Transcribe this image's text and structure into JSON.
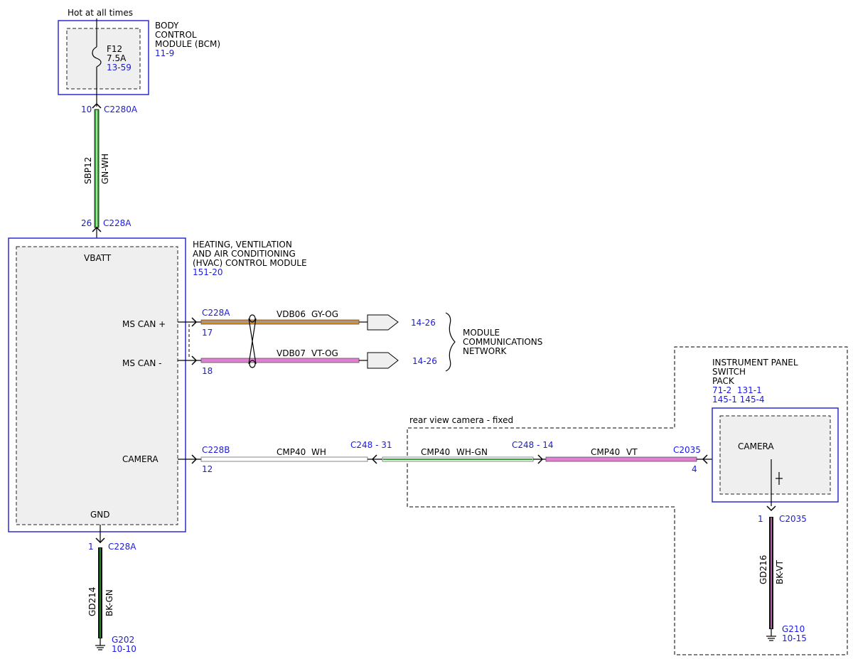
{
  "colors": {
    "module_border": "#2b2bd6",
    "module_fill": "#efefef",
    "reference_text": "#1a1ae0",
    "wire_green": "#2fa82f",
    "wire_white": "#ffffff",
    "wire_black": "#111111",
    "wire_gray": "#9a9a9a",
    "wire_orange": "#e08a1e",
    "wire_violet": "#e27fd2"
  },
  "bcm": {
    "power_label": "Hot at all times",
    "title_lines": [
      "BODY",
      "CONTROL",
      "MODULE (BCM)"
    ],
    "page_ref": "11-9",
    "fuse": {
      "name": "F12",
      "rating": "7.5A",
      "page_ref": "13-59"
    },
    "connector": {
      "pin": "10",
      "name": "C2280A"
    }
  },
  "feed_wire": {
    "circuit": "SBP12",
    "color_code": "GN-WH"
  },
  "hvac": {
    "title_lines": [
      "HEATING, VENTILATION",
      "AND AIR CONDITIONING",
      "(HVAC) CONTROL MODULE"
    ],
    "page_ref": "151-20",
    "feed_connector": {
      "pin": "26",
      "name": "C228A"
    },
    "pins": {
      "vbatt": "VBATT",
      "ms_can_plus": "MS CAN +",
      "ms_can_minus": "MS CAN -",
      "camera": "CAMERA",
      "gnd": "GND"
    },
    "ground_connector": {
      "pin": "1",
      "name": "C228A"
    }
  },
  "can_bus": {
    "connector": "C228A",
    "plus": {
      "pin": "17",
      "circuit": "VDB06",
      "color_code": "GY-OG",
      "page_ref": "14-26"
    },
    "minus": {
      "pin": "18",
      "circuit": "VDB07",
      "color_code": "VT-OG",
      "page_ref": "14-26"
    },
    "network_lines": [
      "MODULE",
      "COMMUNICATIONS",
      "NETWORK"
    ]
  },
  "camera_circuit": {
    "option_label": "rear view camera - fixed",
    "seg1": {
      "connector": "C228B",
      "pin": "12",
      "circuit": "CMP40",
      "color_code": "WH"
    },
    "inline1": "C248 - 31",
    "seg2": {
      "circuit": "CMP40",
      "color_code": "WH-GN"
    },
    "inline2": "C248 - 14",
    "seg3": {
      "circuit": "CMP40",
      "color_code": "VT"
    },
    "end_connector": {
      "name": "C2035",
      "pin": "4"
    }
  },
  "ipsp": {
    "title_lines": [
      "INSTRUMENT PANEL",
      "SWITCH",
      "PACK"
    ],
    "page_refs": [
      "71-2  131-1",
      "145-1 145-4"
    ],
    "pin": "CAMERA",
    "ground_connector": {
      "pin": "1",
      "name": "C2035"
    }
  },
  "ground1": {
    "circuit": "GD214",
    "color_code": "BK-GN",
    "ground": "G202",
    "page_ref": "10-10"
  },
  "ground2": {
    "circuit": "GD216",
    "color_code": "BK-VT",
    "ground": "G210",
    "page_ref": "10-15"
  }
}
